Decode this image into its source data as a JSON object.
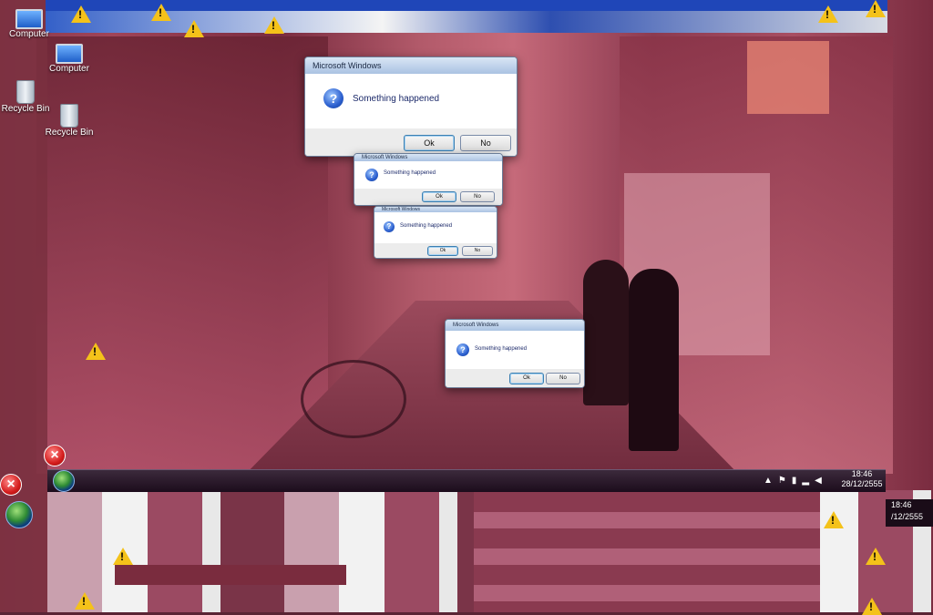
{
  "desktop": {
    "icons": [
      {
        "label": "Computer",
        "icon": "computer-icon"
      },
      {
        "label": "Computer",
        "icon": "computer-icon"
      },
      {
        "label": "Recycle Bin",
        "icon": "recycle-bin-icon"
      },
      {
        "label": "Recycle Bin",
        "icon": "recycle-bin-icon"
      }
    ]
  },
  "dialogs": [
    {
      "title": "Microsoft Windows",
      "message": "Something happened",
      "ok_label": "Ok",
      "cancel_label": "No"
    },
    {
      "title": "Microsoft Windows",
      "message": "Something happened",
      "ok_label": "Ok",
      "cancel_label": "No"
    },
    {
      "title": "Microsoft Windows",
      "message": "Something happened",
      "ok_label": "Ok",
      "cancel_label": "No"
    },
    {
      "title": "Microsoft Windows",
      "message": "Something happened",
      "ok_label": "Ok",
      "cancel_label": "No"
    }
  ],
  "taskbar": {
    "clock_time": "18:46",
    "clock_date": "28/12/2555",
    "clock2_time": "18:46",
    "clock2_date": "/12/2555"
  },
  "colors": {
    "tint": "#a04458",
    "warning": "#f4c21a",
    "error": "#d41c1c",
    "accent": "#2b5fcf"
  }
}
